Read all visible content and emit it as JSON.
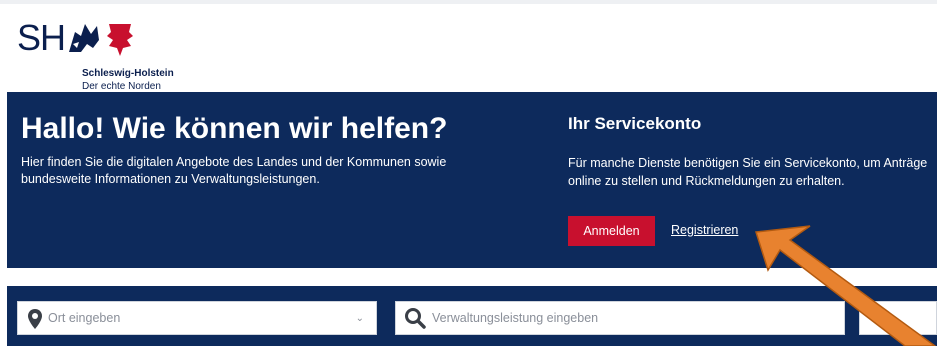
{
  "header": {
    "logo_abbr": "SH",
    "logo_name": "Schleswig-Holstein",
    "logo_tagline": "Der echte Norden"
  },
  "hero": {
    "title": "Hallo! Wie können wir helfen?",
    "description": "Hier finden Sie die digitalen Angebote des Landes und der Kommunen sowie bundesweite Informationen zu Verwaltungsleistungen."
  },
  "servicekonto": {
    "title": "Ihr Servicekonto",
    "description": "Für manche Dienste benötigen Sie ein Servicekonto, um Anträge online zu stellen und Rückmeldungen zu erhalten.",
    "login_label": "Anmelden",
    "register_label": "Registrieren"
  },
  "search": {
    "location_placeholder": "Ort eingeben",
    "service_placeholder": "Verwaltungsleistung eingeben"
  },
  "colors": {
    "navy": "#0d2a5c",
    "brand_red": "#c8102e",
    "arrow": "#e8822f"
  },
  "icons": {
    "location": "map-pin-icon",
    "search": "search-icon",
    "dropdown": "chevron-down-icon"
  }
}
